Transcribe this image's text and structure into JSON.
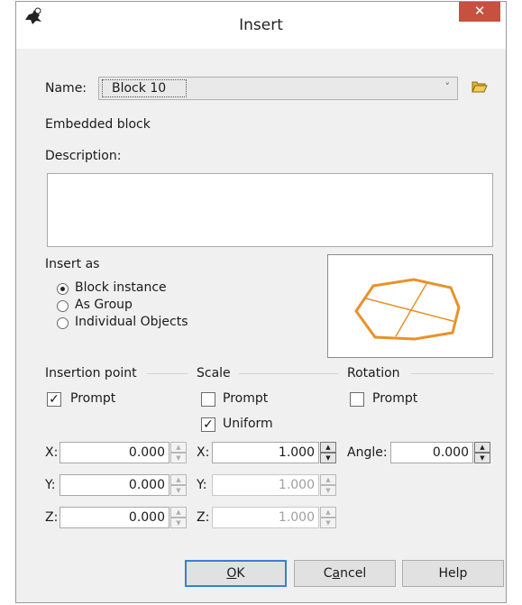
{
  "window": {
    "title": "Insert",
    "close_glyph": "✕"
  },
  "name": {
    "label": "Name:",
    "value": "Block 10",
    "dropdown_glyph": "˅"
  },
  "block_type": "Embedded block",
  "description": {
    "label": "Description:",
    "value": ""
  },
  "insert_as": {
    "label": "Insert as",
    "options": [
      "Block instance",
      "As Group",
      "Individual Objects"
    ],
    "selected": "Block instance"
  },
  "insertion_point": {
    "label": "Insertion point",
    "prompt_label": "Prompt",
    "prompt_checked": true,
    "x_label": "X:",
    "x": "0.000",
    "y_label": "Y:",
    "y": "0.000",
    "z_label": "Z:",
    "z": "0.000"
  },
  "scale": {
    "label": "Scale",
    "prompt_label": "Prompt",
    "prompt_checked": false,
    "uniform_label": "Uniform",
    "uniform_checked": true,
    "x_label": "X:",
    "x": "1.000",
    "y_label": "Y:",
    "y": "1.000",
    "z_label": "Z:",
    "z": "1.000"
  },
  "rotation": {
    "label": "Rotation",
    "prompt_label": "Prompt",
    "prompt_checked": false,
    "angle_label": "Angle:",
    "angle": "0.000"
  },
  "buttons": {
    "ok_mnemonic": "O",
    "ok_rest": "K",
    "cancel_first": "C",
    "cancel_mnemonic": "a",
    "cancel_rest": "ncel",
    "help": "Help"
  },
  "check_glyph": "✓",
  "icons": {
    "app": "rhino-app-icon",
    "folder": "folder-open-icon",
    "preview": "block-preview-octagon"
  },
  "colors": {
    "preview_stroke": "#e8922a",
    "close_button": "#c7503f",
    "default_button_border": "#3c7fd1"
  }
}
